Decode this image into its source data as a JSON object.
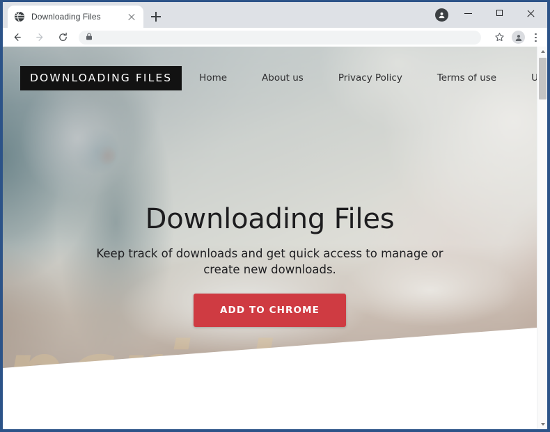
{
  "browser": {
    "tab": {
      "title": "Downloading Files",
      "favicon": "globe-icon",
      "close_label": "×"
    },
    "new_tab_label": "+",
    "toolbar": {
      "back_label": "←",
      "forward_label": "→",
      "reload_label": "⟳",
      "address_value": "",
      "address_placeholder": "",
      "lock_icon": "lock-icon",
      "bookmark_icon": "star-icon",
      "profile_icon": "account-icon",
      "menu_icon": "three-dots-icon"
    },
    "window_controls": {
      "minimize": "–",
      "maximize": "□",
      "close": "✕"
    },
    "scrollbar": {
      "up_arrow": "▲",
      "down_arrow": "▼"
    }
  },
  "page": {
    "logo": "DOWNLOADING FILES",
    "nav": [
      {
        "label": "Home"
      },
      {
        "label": "About us"
      },
      {
        "label": "Privacy Policy"
      },
      {
        "label": "Terms of use"
      },
      {
        "label": "Uninstall"
      }
    ],
    "hero": {
      "title": "Downloading Files",
      "subtitle": "Keep track of downloads and get quick access to manage or create new downloads.",
      "cta_label": "ADD TO CHROME",
      "watermark": "pcrisk.com"
    },
    "colors": {
      "cta_red": "#cf3b42",
      "logo_background": "#121212",
      "window_border_blue": "#2c5388",
      "tabstrip_gray": "#dee1e6"
    }
  }
}
